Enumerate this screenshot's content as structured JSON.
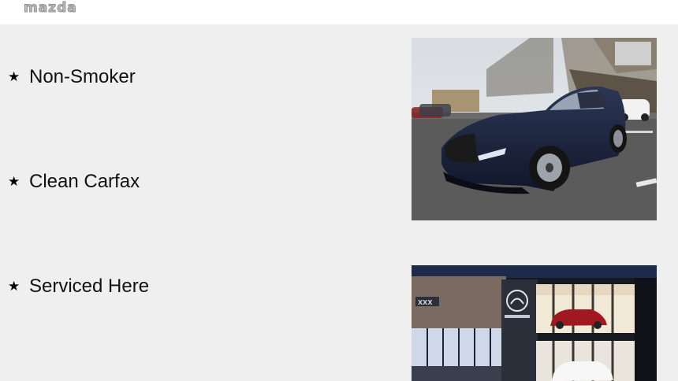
{
  "header": {
    "logo_text": "mazda",
    "logo_icon": "mazda-wordmark"
  },
  "features": [
    {
      "icon": "star-icon",
      "star": "★",
      "label": "Non-Smoker"
    },
    {
      "icon": "star-icon",
      "star": "★",
      "label": "Clean Carfax"
    },
    {
      "icon": "star-icon",
      "star": "★",
      "label": "Serviced Here"
    }
  ],
  "colors": {
    "background": "#efefef",
    "header_bg": "#ffffff",
    "text": "#111111",
    "car_paint": "#1b2440"
  }
}
